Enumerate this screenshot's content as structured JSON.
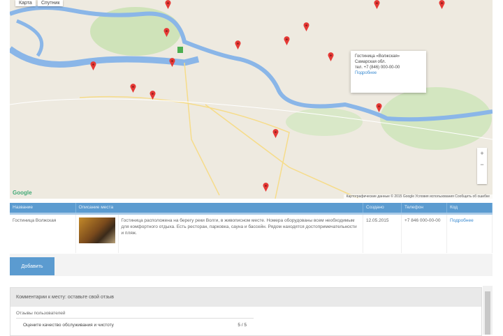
{
  "map": {
    "type_buttons": [
      "Карта",
      "Спутник"
    ],
    "zoom_in": "+",
    "zoom_out": "−",
    "logo": "Google",
    "attribution": "Картографические данные © 2015 Google  Условия использования  Сообщить об ошибке",
    "infowindow": {
      "title": "Гостиница «Волжская»",
      "line1": "Самарская обл.",
      "line2": "тел. +7 (846) 000-00-00",
      "link": "Подробнее"
    },
    "marker_color": "#e53935",
    "river_color": "#8ab6e8"
  },
  "table": {
    "headers": [
      "Название",
      "Описание места",
      "Создано",
      "Телефон",
      "Код"
    ],
    "rows": [
      {
        "name": "Гостиница Волжская",
        "description": "Гостиница расположена на берегу реки Волги, в живописном месте. Номера оборудованы всем необходимым для комфортного отдыха. Есть ресторан, парковка, сауна и бассейн. Рядом находятся достопримечательности и пляж.",
        "created": "12.05.2015",
        "phone": "+7 846 000-00-00",
        "link": "Подробнее"
      }
    ]
  },
  "add_button": "Добавить",
  "panel": {
    "title": "Комментарии к месту: оставьте свой отзыв",
    "fieldset": "Отзывы пользователей",
    "item_label": "Оцените качество обслуживания и чистоту",
    "item_value": "5 / 5"
  }
}
